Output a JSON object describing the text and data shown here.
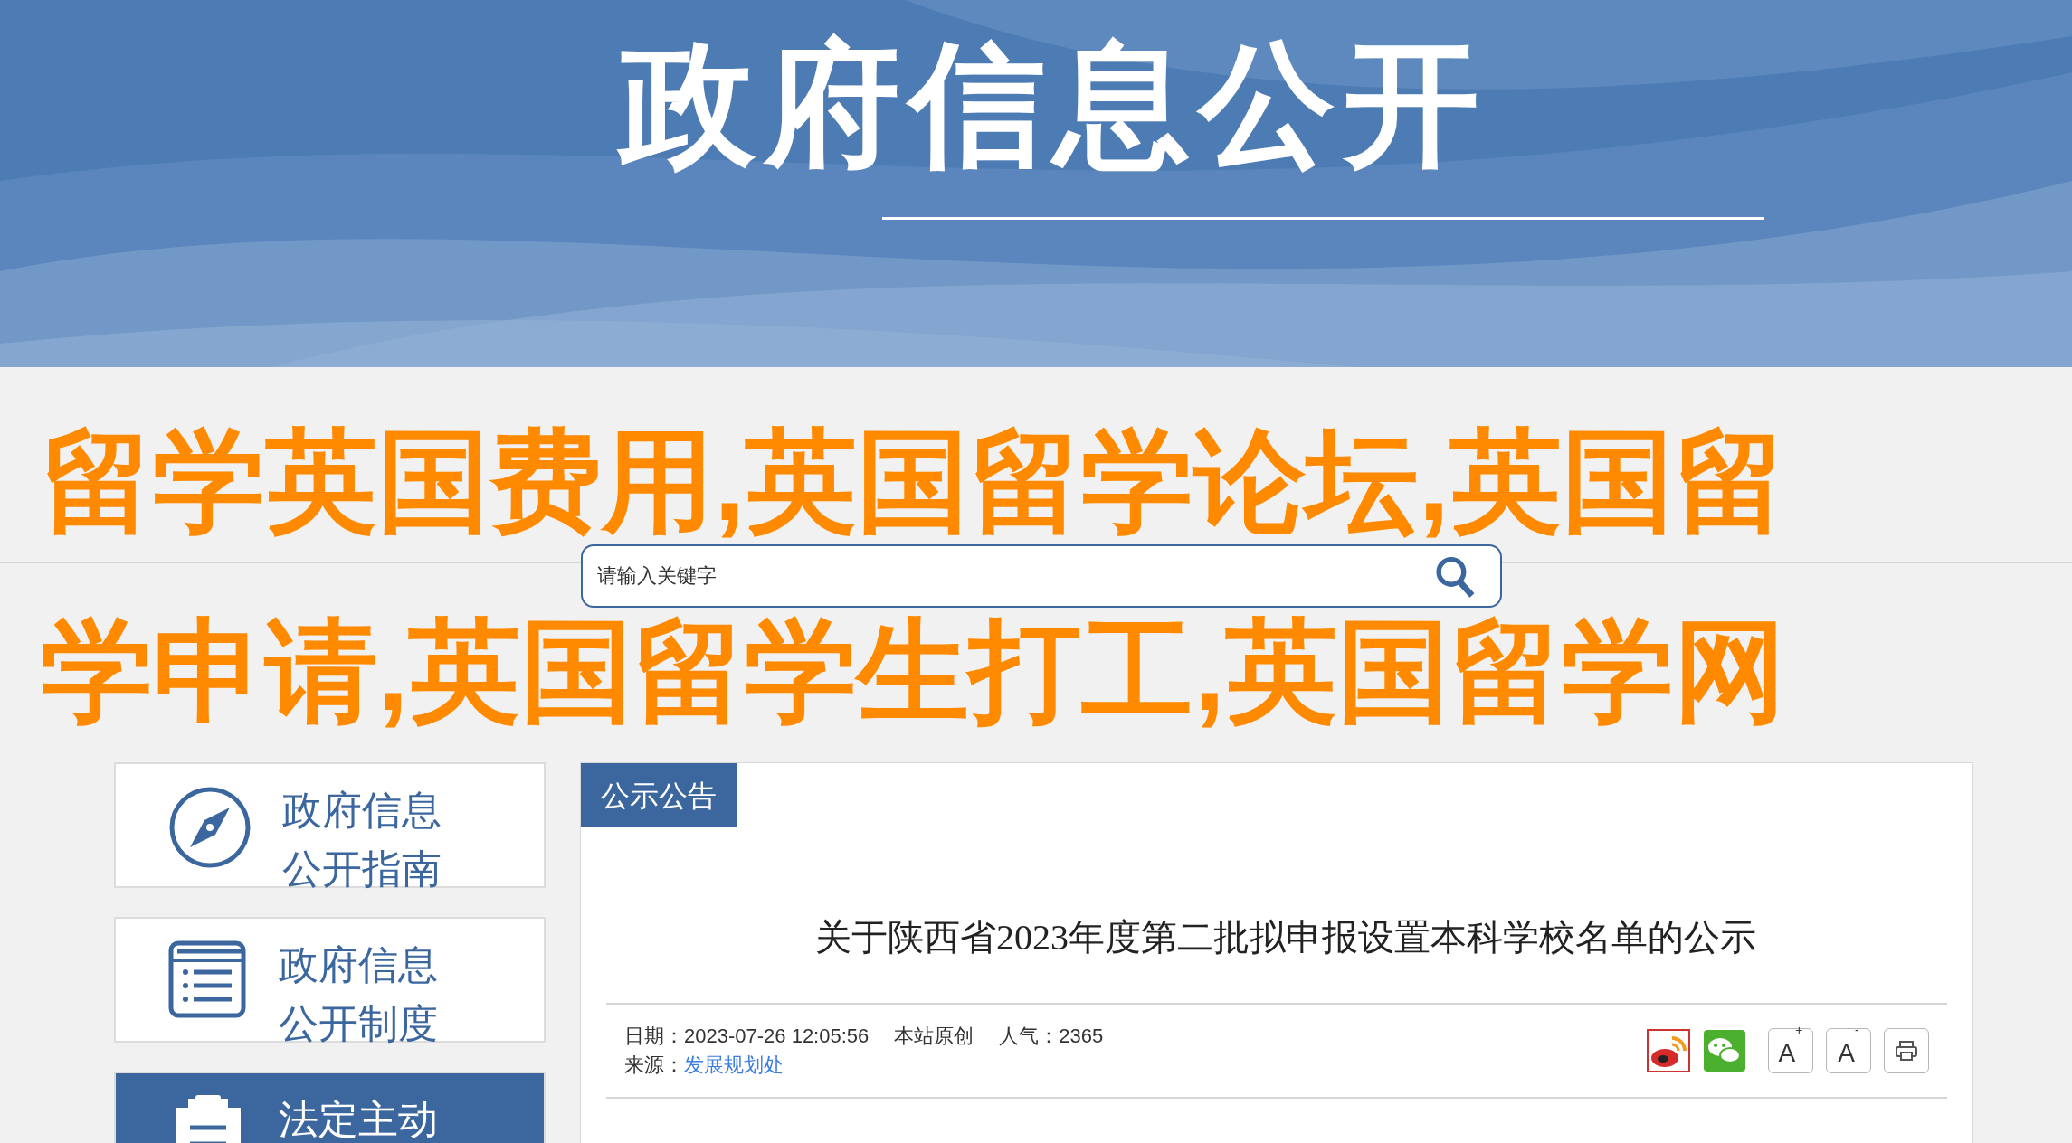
{
  "header": {
    "title": "政府信息公开"
  },
  "page_title": [
    "留学英国费用,英国留学论坛,英国留",
    "学申请,英国留学生打工,英国留学网"
  ],
  "search": {
    "placeholder": "请输入关键字"
  },
  "sidebar": {
    "items": [
      {
        "label": [
          "政府信息",
          "公开指南"
        ],
        "kind": "compass",
        "selected": false
      },
      {
        "label": [
          "政府信息",
          "公开制度"
        ],
        "kind": "list",
        "selected": false
      },
      {
        "label": [
          "法定主动"
        ],
        "kind": "clipboard",
        "selected": true
      }
    ]
  },
  "article": {
    "tab": "公示公告",
    "title": "关于陕西省2023年度第二批拟申报设置本科学校名单的公示",
    "meta": {
      "date_label": "日期：",
      "date": "2023-07-26 12:05:56",
      "origin": "本站原创",
      "views_label": "人气：",
      "views": "2365",
      "source_label": "来源：",
      "source": "发展规划处"
    },
    "tools": [
      {
        "kind": "weibo"
      },
      {
        "kind": "wechat"
      },
      {
        "kind": "font-larger",
        "label": "A",
        "mark": "+"
      },
      {
        "kind": "font-smaller",
        "label": "A",
        "mark": "-"
      },
      {
        "kind": "print"
      }
    ]
  }
}
